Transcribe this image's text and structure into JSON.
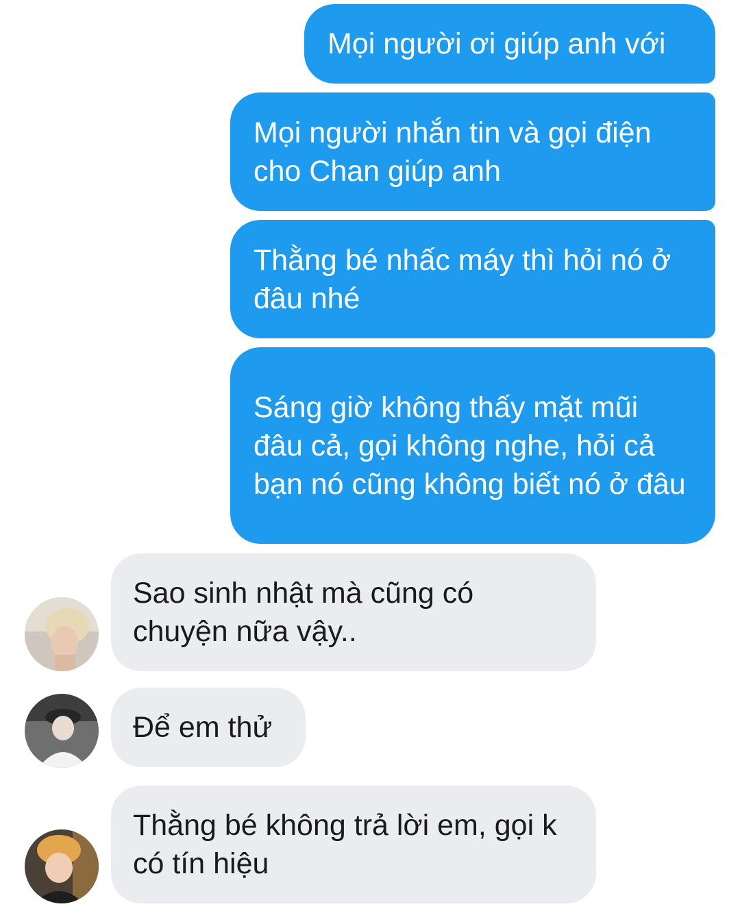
{
  "conversation": {
    "messages": [
      {
        "sender": "me",
        "text": "Mọi người ơi giúp anh với"
      },
      {
        "sender": "me",
        "text": "Mọi người nhắn tin và gọi điện cho Chan giúp anh"
      },
      {
        "sender": "me",
        "text": "Thằng bé nhấc máy thì hỏi nó ở đâu nhé"
      },
      {
        "sender": "me",
        "text": "Sáng giờ không thấy mặt mũi đâu cả, gọi không nghe, hỏi cả bạn nó cũng không biết nó ở đâu"
      },
      {
        "sender": "other-1",
        "text": "Sao sinh nhật mà cũng có chuyện nữa vậy.."
      },
      {
        "sender": "other-2",
        "text": "Để em thử"
      },
      {
        "sender": "other-3",
        "text": "Thằng bé không trả lời em, gọi k có tín hiệu"
      }
    ]
  },
  "colors": {
    "outgoing_bubble": "#1e9bef",
    "incoming_bubble": "#ebecf0",
    "background": "#ffffff"
  },
  "icons": {
    "avatar_1": "avatar-photo",
    "avatar_2": "avatar-photo",
    "avatar_3": "avatar-photo"
  }
}
